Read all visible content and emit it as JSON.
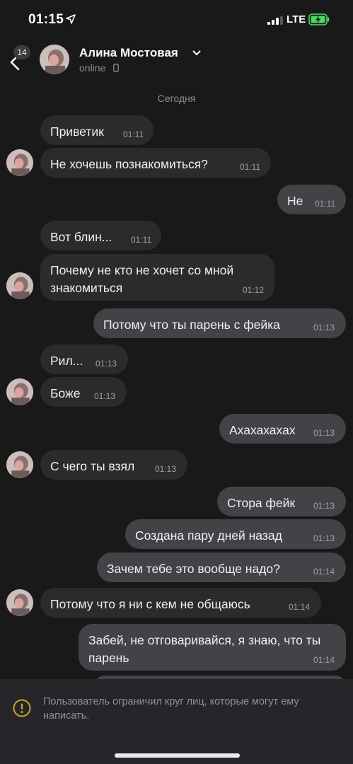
{
  "status_bar": {
    "time": "01:15",
    "network": "LTE"
  },
  "header": {
    "back_badge": "14",
    "contact_name": "Алина Мостовая",
    "contact_status": "online"
  },
  "date_separator": "Сегодня",
  "messages": [
    {
      "dir": "in",
      "text": "Приветик",
      "time": "01:11"
    },
    {
      "dir": "in",
      "text": "Не хочешь познакомиться?",
      "time": "01:11"
    },
    {
      "dir": "out",
      "text": "Не",
      "time": "01:11"
    },
    {
      "dir": "in",
      "text": "Вот блин...",
      "time": "01:11"
    },
    {
      "dir": "in",
      "text": "Почему не кто не хочет со мной знакомиться",
      "time": "01:12"
    },
    {
      "dir": "out",
      "text": "Потому что ты парень с фейка",
      "time": "01:13"
    },
    {
      "dir": "in",
      "text": "Рил...",
      "time": "01:13"
    },
    {
      "dir": "in",
      "text": "Боже",
      "time": "01:13"
    },
    {
      "dir": "out",
      "text": "Ахахахахах",
      "time": "01:13"
    },
    {
      "dir": "in",
      "text": "С чего ты взял",
      "time": "01:13"
    },
    {
      "dir": "out",
      "text": "Стора фейк",
      "time": "01:13"
    },
    {
      "dir": "out",
      "text": "Создана пару дней назад",
      "time": "01:13"
    },
    {
      "dir": "out",
      "text": "Зачем тебе это вообще надо?",
      "time": "01:14"
    },
    {
      "dir": "in",
      "text": "Потому что я ни с кем не общаюсь",
      "time": "01:14"
    },
    {
      "dir": "out",
      "text": "Забей, не отговаривайся, я знаю, что ты парень",
      "time": "01:14"
    }
  ],
  "restriction_notice": "Пользователь ограничил круг лиц, которые могут ему написать.",
  "icons": [
    "location-arrow-icon",
    "signal-icon",
    "battery-charging-icon",
    "back-chevron-icon",
    "chevron-down-icon",
    "phone-icon",
    "warning-icon"
  ],
  "colors": {
    "background": "#19191a",
    "incoming_bubble": "#2b2b2e",
    "outgoing_bubble": "#434347",
    "warning": "#c9a227",
    "battery": "#4cd964"
  }
}
